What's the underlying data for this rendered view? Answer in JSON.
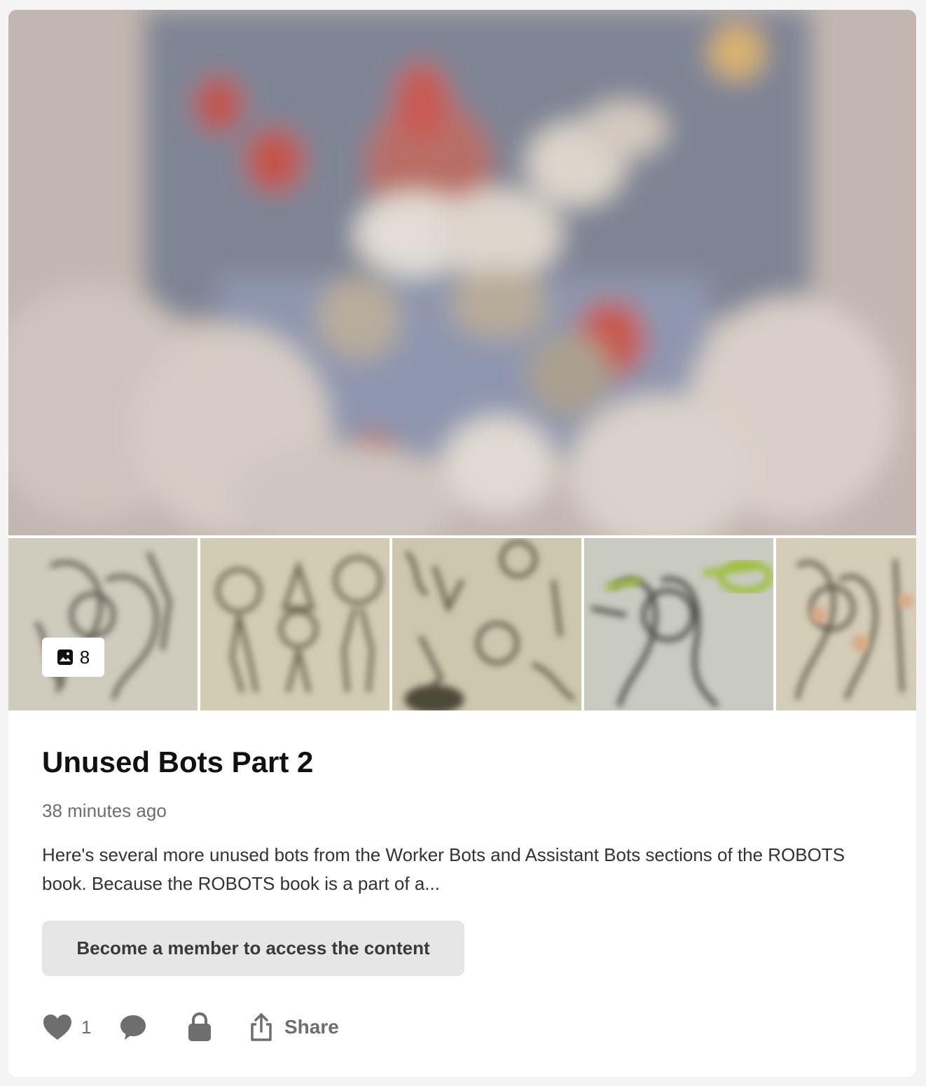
{
  "post": {
    "title": "Unused Bots Part 2",
    "time": "38 minutes ago",
    "excerpt": "Here's several more unused bots from the Worker Bots and Assistant Bots sections of the ROBOTS book. Because the ROBOTS book is a part of a...",
    "image_count": "8",
    "cta_label": "Become a member to access the content"
  },
  "actions": {
    "like_count": "1",
    "share_label": "Share"
  },
  "icons": {
    "image_count": "image-icon",
    "like": "heart-icon",
    "comment": "comment-icon",
    "locked": "lock-icon",
    "share": "share-icon"
  },
  "colors": {
    "card_bg": "#ffffff",
    "page_bg": "#f4f4f4",
    "cta_bg": "#e6e6e6",
    "icon_gray": "#6e6e6e",
    "text_primary": "#111111"
  }
}
